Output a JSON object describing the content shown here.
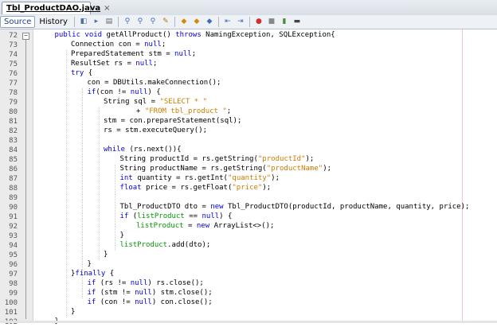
{
  "tab": {
    "filename": "Tbl_ProductDAO.java",
    "close": "×"
  },
  "toolbar": {
    "source_label": "Source",
    "history_label": "History",
    "icons": [
      "back-icon",
      "forward-icon",
      "history-nav-icon",
      "find-prev-icon",
      "find-next-icon",
      "find-selection-icon",
      "toggle-highlight-icon",
      "prev-bookmark-icon",
      "next-bookmark-icon",
      "toggle-bookmark-icon",
      "shift-left-icon",
      "shift-right-icon",
      "record-macro-icon",
      "stop-macro-icon",
      "comment-icon",
      "uncomment-icon"
    ]
  },
  "editor": {
    "lines": [
      {
        "n": "72",
        "fold": "−",
        "indent": 1,
        "tokens": [
          [
            "kw",
            "public void "
          ],
          [
            "",
            "getAllProduct() "
          ],
          [
            "kw",
            "throws "
          ],
          [
            "",
            "NamingException, SQLException{"
          ]
        ]
      },
      {
        "n": "73",
        "indent": 2,
        "tokens": [
          [
            "",
            "Connection con = "
          ],
          [
            "kw",
            "null"
          ],
          [
            "",
            ";"
          ]
        ]
      },
      {
        "n": "74",
        "indent": 2,
        "tokens": [
          [
            "",
            "PreparedStatement stm = "
          ],
          [
            "kw",
            "null"
          ],
          [
            "",
            ";"
          ]
        ]
      },
      {
        "n": "75",
        "indent": 2,
        "tokens": [
          [
            "",
            "ResultSet rs = "
          ],
          [
            "kw",
            "null"
          ],
          [
            "",
            ";"
          ]
        ]
      },
      {
        "n": "76",
        "indent": 2,
        "tokens": [
          [
            "kw",
            "try "
          ],
          [
            "",
            "{"
          ]
        ]
      },
      {
        "n": "77",
        "indent": 3,
        "tokens": [
          [
            "",
            "con = DBUtils.makeConnection();"
          ]
        ]
      },
      {
        "n": "78",
        "indent": 3,
        "tokens": [
          [
            "kw",
            "if"
          ],
          [
            "",
            "(con != "
          ],
          [
            "kw",
            "null"
          ],
          [
            "",
            ") {"
          ]
        ]
      },
      {
        "n": "79",
        "indent": 4,
        "tokens": [
          [
            "",
            "String sql = "
          ],
          [
            "str",
            "\"SELECT * \""
          ]
        ]
      },
      {
        "n": "80",
        "indent": 6,
        "tokens": [
          [
            "",
            "+ "
          ],
          [
            "str",
            "\"FROM tbl_product \""
          ],
          [
            "",
            ";"
          ]
        ]
      },
      {
        "n": "81",
        "indent": 4,
        "tokens": [
          [
            "",
            "stm = con.prepareStatement(sql);"
          ]
        ]
      },
      {
        "n": "82",
        "indent": 4,
        "tokens": [
          [
            "",
            "rs = stm.executeQuery();"
          ]
        ]
      },
      {
        "n": "83",
        "indent": 0,
        "tokens": []
      },
      {
        "n": "84",
        "indent": 4,
        "tokens": [
          [
            "kw",
            "while "
          ],
          [
            "",
            "(rs.next()){"
          ]
        ]
      },
      {
        "n": "85",
        "indent": 5,
        "tokens": [
          [
            "",
            "String productId = rs.getString("
          ],
          [
            "str",
            "\"productId\""
          ],
          [
            "",
            ");"
          ]
        ]
      },
      {
        "n": "86",
        "indent": 5,
        "tokens": [
          [
            "",
            "String productName = rs.getString("
          ],
          [
            "str",
            "\"productName\""
          ],
          [
            "",
            ");"
          ]
        ]
      },
      {
        "n": "87",
        "indent": 5,
        "tokens": [
          [
            "kw",
            "int "
          ],
          [
            "",
            "quantity = rs.getInt("
          ],
          [
            "str",
            "\"quantity\""
          ],
          [
            "",
            ");"
          ]
        ]
      },
      {
        "n": "88",
        "indent": 5,
        "tokens": [
          [
            "kw",
            "float "
          ],
          [
            "",
            "price = rs.getFloat("
          ],
          [
            "str",
            "\"price\""
          ],
          [
            "",
            ");"
          ]
        ]
      },
      {
        "n": "89",
        "indent": 0,
        "tokens": []
      },
      {
        "n": "90",
        "indent": 5,
        "tokens": [
          [
            "",
            "Tbl_ProductDTO dto = "
          ],
          [
            "kw",
            "new "
          ],
          [
            "",
            "Tbl_ProductDTO(productId, productName, quantity, price);"
          ]
        ]
      },
      {
        "n": "91",
        "indent": 5,
        "tokens": [
          [
            "kw",
            "if "
          ],
          [
            "",
            "("
          ],
          [
            "fld",
            "listProduct"
          ],
          [
            "",
            " == "
          ],
          [
            "kw",
            "null"
          ],
          [
            "",
            ") {"
          ]
        ]
      },
      {
        "n": "92",
        "indent": 6,
        "tokens": [
          [
            "fld",
            "listProduct"
          ],
          [
            "",
            " = "
          ],
          [
            "kw",
            "new "
          ],
          [
            "",
            "ArrayList<>();"
          ]
        ]
      },
      {
        "n": "93",
        "indent": 5,
        "tokens": [
          [
            "",
            "}"
          ]
        ]
      },
      {
        "n": "94",
        "indent": 5,
        "tokens": [
          [
            "fld",
            "listProduct"
          ],
          [
            "",
            ".add(dto);"
          ]
        ]
      },
      {
        "n": "95",
        "indent": 4,
        "tokens": [
          [
            "",
            "}"
          ]
        ]
      },
      {
        "n": "96",
        "indent": 3,
        "tokens": [
          [
            "",
            "}"
          ]
        ]
      },
      {
        "n": "97",
        "indent": 2,
        "tokens": [
          [
            "",
            "}"
          ],
          [
            "kw",
            "finally "
          ],
          [
            "",
            "{"
          ]
        ]
      },
      {
        "n": "98",
        "indent": 3,
        "tokens": [
          [
            "kw",
            "if "
          ],
          [
            "",
            "(rs != "
          ],
          [
            "kw",
            "null"
          ],
          [
            "",
            ") rs.close();"
          ]
        ]
      },
      {
        "n": "99",
        "indent": 3,
        "tokens": [
          [
            "kw",
            "if "
          ],
          [
            "",
            "(stm != "
          ],
          [
            "kw",
            "null"
          ],
          [
            "",
            ") stm.close();"
          ]
        ]
      },
      {
        "n": "100",
        "indent": 3,
        "tokens": [
          [
            "kw",
            "if "
          ],
          [
            "",
            "(con != "
          ],
          [
            "kw",
            "null"
          ],
          [
            "",
            ") con.close();"
          ]
        ]
      },
      {
        "n": "101",
        "indent": 2,
        "tokens": [
          [
            "",
            "}"
          ]
        ]
      },
      {
        "n": "102",
        "indent": 1,
        "tokens": [
          [
            "",
            "}"
          ]
        ]
      }
    ]
  },
  "colors": {
    "keyword": "#0000e6",
    "string": "#ce7b00",
    "field": "#009900"
  }
}
